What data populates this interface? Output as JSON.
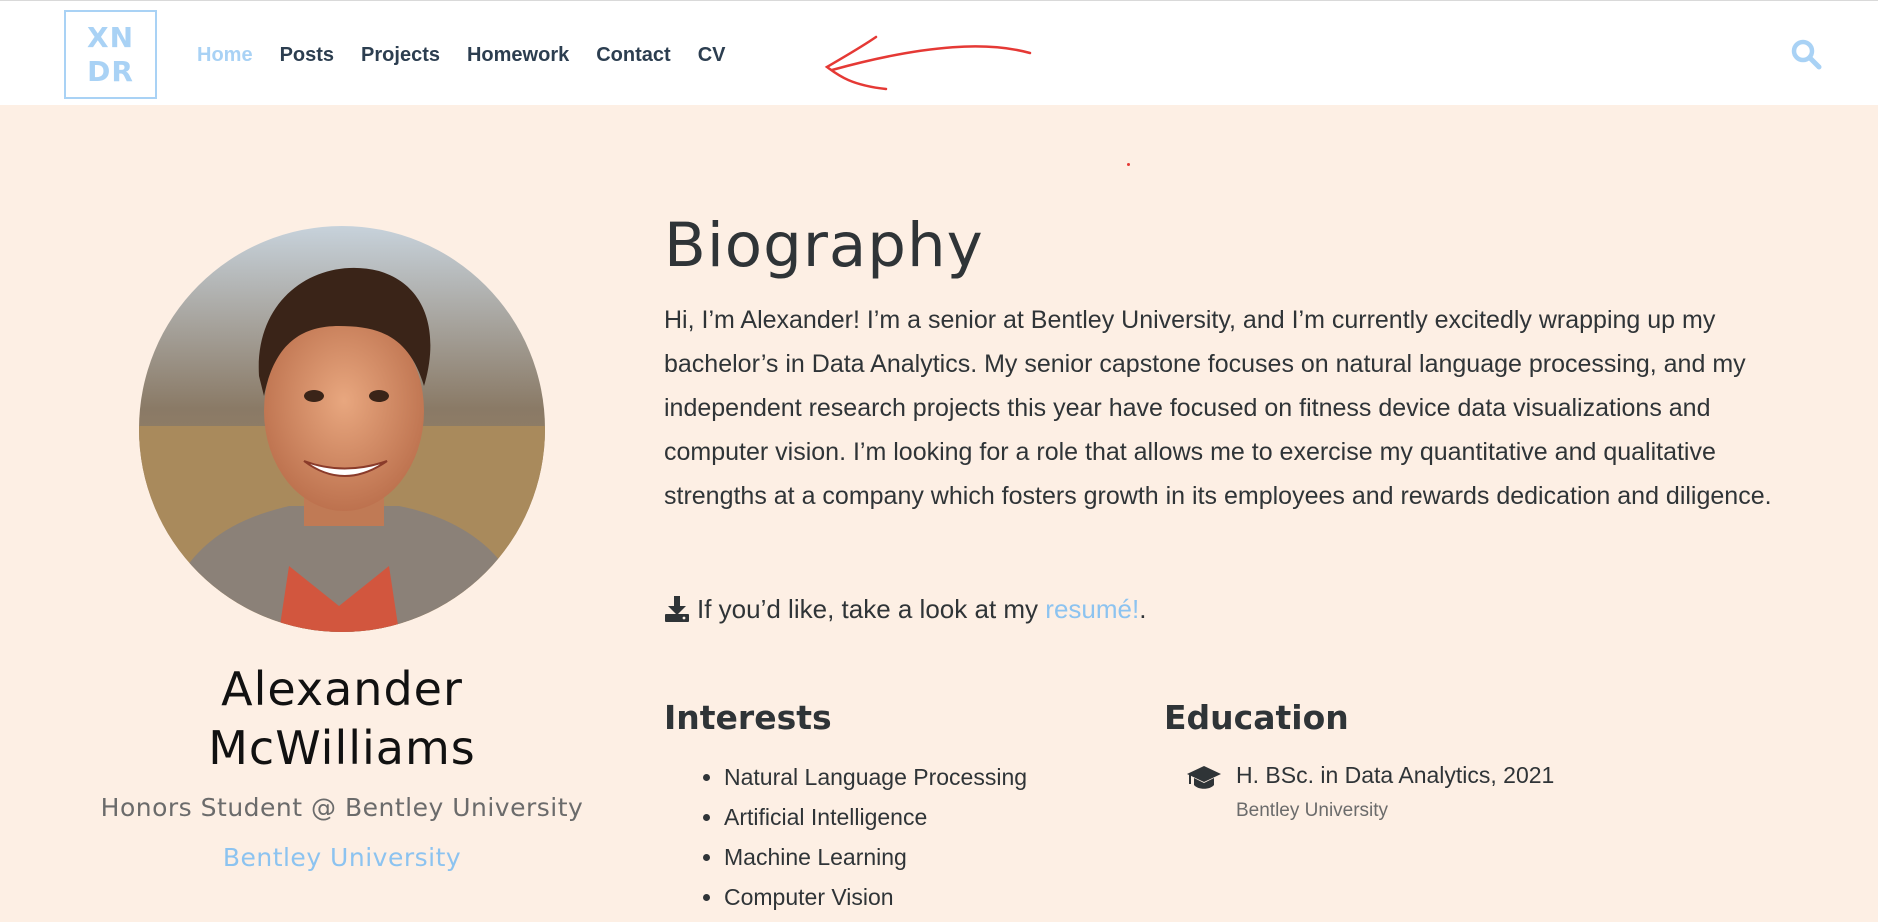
{
  "navbar": {
    "logo_line1": "XN",
    "logo_line2": "DR",
    "links": [
      {
        "label": "Home",
        "active": true
      },
      {
        "label": "Posts"
      },
      {
        "label": "Projects"
      },
      {
        "label": "Homework"
      },
      {
        "label": "Contact"
      },
      {
        "label": "CV"
      }
    ],
    "search_icon": "search-icon"
  },
  "profile": {
    "name": "Alexander McWilliams",
    "role": "Honors Student @ Bentley University",
    "organization": "Bentley University"
  },
  "biography": {
    "heading": "Biography",
    "text": "Hi, I’m Alexander! I’m a senior at Bentley University, and I’m currently excitedly wrapping up my bachelor’s in Data Analytics. My senior capstone focuses on natural language processing, and my independent research projects this year have focused on fitness device data visualizations and computer vision. I’m looking for a role that allows me to exercise my quantitative and qualitative strengths at a company which fosters growth in its employees and rewards dedication and diligence.",
    "resume_prefix": "If you’d like, take a look at my",
    "resume_link": "resumé!",
    "resume_suffix": "."
  },
  "interests": {
    "heading": "Interests",
    "items": [
      "Natural Language Processing",
      "Artificial Intelligence",
      "Machine Learning",
      "Computer Vision"
    ]
  },
  "education": {
    "heading": "Education",
    "degree": "H. BSc. in Data Analytics, 2021",
    "school": "Bentley University"
  },
  "colors": {
    "accent": "#8cc3f0",
    "page_background": "#fdefe4",
    "annotation": "#e53935"
  }
}
